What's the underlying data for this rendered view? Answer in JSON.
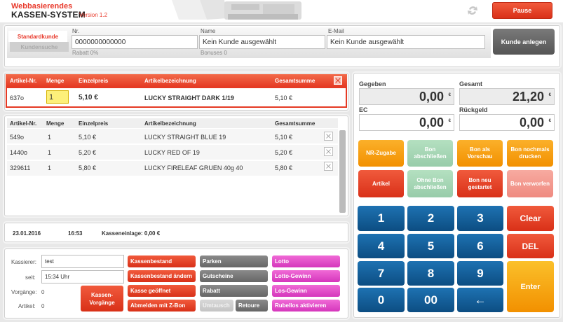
{
  "header": {
    "brand_line1": "Webbasierendes",
    "brand_line2": "KASSEN-SYSTEM",
    "version": "Version 1.2",
    "pause_label": "Pause"
  },
  "customer": {
    "tab_standard": "Standardkunde",
    "tab_search": "Kundensuche",
    "nr_label": "Nr.",
    "nr_value": "0000000000000",
    "rabatt": "Rabatt 0%",
    "name_label": "Name",
    "name_value": "Kein Kunde ausgewählt",
    "bonuses": "Bonuses 0",
    "email_label": "E-Mail",
    "email_value": "Kein Kunde ausgewählt",
    "create_button": "Kunde anlegen"
  },
  "columns": {
    "artnr": "Artikel-Nr.",
    "menge": "Menge",
    "einzelpreis": "Einzelpreis",
    "bezeichnung": "Artikelbezeichnung",
    "gesamt": "Gesamtsumme"
  },
  "current_item": {
    "artnr": "637o",
    "menge": "1",
    "einzelpreis": "5,10 €",
    "bezeichnung": "LUCKY STRAIGHT DARK 1/19",
    "gesamt": "5,10 €"
  },
  "items": [
    {
      "artnr": "549o",
      "menge": "1",
      "einzelpreis": "5,10 €",
      "bezeichnung": "LUCKY STRAIGHT BLUE 19",
      "gesamt": "5,10 €"
    },
    {
      "artnr": "1440o",
      "menge": "1",
      "einzelpreis": "5,20 €",
      "bezeichnung": "LUCKY RED OF 19",
      "gesamt": "5,20 €"
    },
    {
      "artnr": "329611",
      "menge": "1",
      "einzelpreis": "5,80 €",
      "bezeichnung": "LUCKY FIRELEAF GRUEN 40g 40",
      "gesamt": "5,80 €"
    }
  ],
  "info": {
    "date": "23.01.2016",
    "time": "16:53",
    "kasseneinlage": "Kasseneinlage: 0,00 €"
  },
  "staff": {
    "kassierer_label": "Kassierer:",
    "kassierer_value": "test",
    "seit_label": "seit:",
    "seit_value": "15:34 Uhr",
    "vorgaenge_label": "Vorgänge:",
    "vorgaenge_value": "0",
    "artikel_label": "Artikel:",
    "artikel_value": "0",
    "kassen_vorgaenge": "Kassen-Vorgänge"
  },
  "actions": {
    "kassenbestand": "Kassenbestand",
    "kassenbestand_aendern": "Kassenbestand ändern",
    "kasse_geoeffnet": "Kasse geöffnet",
    "abmelden": "Abmelden mit Z-Bon",
    "parken": "Parken",
    "gutscheine": "Gutscheine",
    "rabatt": "Rabatt",
    "umtausch": "Umtausch",
    "retoure": "Retoure",
    "lotto": "Lotto",
    "lotto_gewinn": "Lotto-Gewinn",
    "los_gewinn": "Los-Gewinn",
    "rubellos": "Rubellos aktivieren"
  },
  "amounts": {
    "gegeben_label": "Gegeben",
    "gegeben_value": "0,00",
    "gesamt_label": "Gesamt",
    "gesamt_value": "21,20",
    "ec_label": "EC",
    "ec_value": "0,00",
    "rueckgeld_label": "Rückgeld",
    "rueckgeld_value": "0,00",
    "currency": "€"
  },
  "functions": {
    "nr_zugabe": "NR-Zugabe",
    "bon_abschliessen": "Bon abschließen",
    "bon_vorschau": "Bon als Vorschau",
    "bon_nochmals": "Bon nochmals drucken",
    "artikel": "Artikel",
    "ohne_bon": "Ohne Bon abschließen",
    "bon_neu": "Bon neu gestartet",
    "bon_verworfen": "Bon verworfen"
  },
  "keypad": {
    "k1": "1",
    "k2": "2",
    "k3": "3",
    "k4": "4",
    "k5": "5",
    "k6": "6",
    "k7": "7",
    "k8": "8",
    "k9": "9",
    "k0": "0",
    "k00": "00",
    "back": "←",
    "clear": "Clear",
    "del": "DEL",
    "enter": "Enter"
  },
  "colors": {
    "accent_red": "#e8392b",
    "keypad_blue": "#0c4d82",
    "orange": "#f29000",
    "pink": "#d536bc"
  }
}
